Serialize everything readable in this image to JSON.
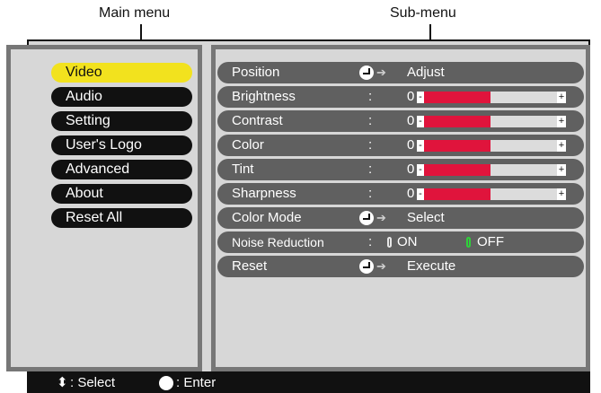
{
  "callouts": {
    "main": "Main menu",
    "sub": "Sub-menu"
  },
  "main_menu": {
    "items": [
      {
        "label": "Video",
        "selected": true
      },
      {
        "label": "Audio",
        "selected": false
      },
      {
        "label": "Setting",
        "selected": false
      },
      {
        "label": "User's Logo",
        "selected": false
      },
      {
        "label": "Advanced",
        "selected": false
      },
      {
        "label": "About",
        "selected": false
      },
      {
        "label": "Reset All",
        "selected": false
      }
    ]
  },
  "submenu": {
    "position": {
      "label": "Position",
      "action": "Adjust"
    },
    "sliders": [
      {
        "label": "Brightness",
        "colon": ":",
        "value": "0",
        "minus": "-",
        "plus": "+",
        "level": 0.5
      },
      {
        "label": "Contrast",
        "colon": ":",
        "value": "0",
        "minus": "-",
        "plus": "+",
        "level": 0.5
      },
      {
        "label": "Color",
        "colon": ":",
        "value": "0",
        "minus": "-",
        "plus": "+",
        "level": 0.5
      },
      {
        "label": "Tint",
        "colon": ":",
        "value": "0",
        "minus": "-",
        "plus": "+",
        "level": 0.5
      },
      {
        "label": "Sharpness",
        "colon": ":",
        "value": "0",
        "minus": "-",
        "plus": "+",
        "level": 0.5
      }
    ],
    "color_mode": {
      "label": "Color Mode",
      "action": "Select"
    },
    "noise_reduction": {
      "label": "Noise Reduction",
      "colon": ":",
      "on_label": "ON",
      "off_label": "OFF",
      "selected": "OFF"
    },
    "reset": {
      "label": "Reset",
      "action": "Execute"
    }
  },
  "footer": {
    "select_hint": ": Select",
    "enter_hint": ": Enter"
  },
  "colors": {
    "selected_bg": "#f2e21e",
    "slider_fill": "#e0143c",
    "on_indicator": "#2fd13a",
    "row_bg": "#606060"
  }
}
